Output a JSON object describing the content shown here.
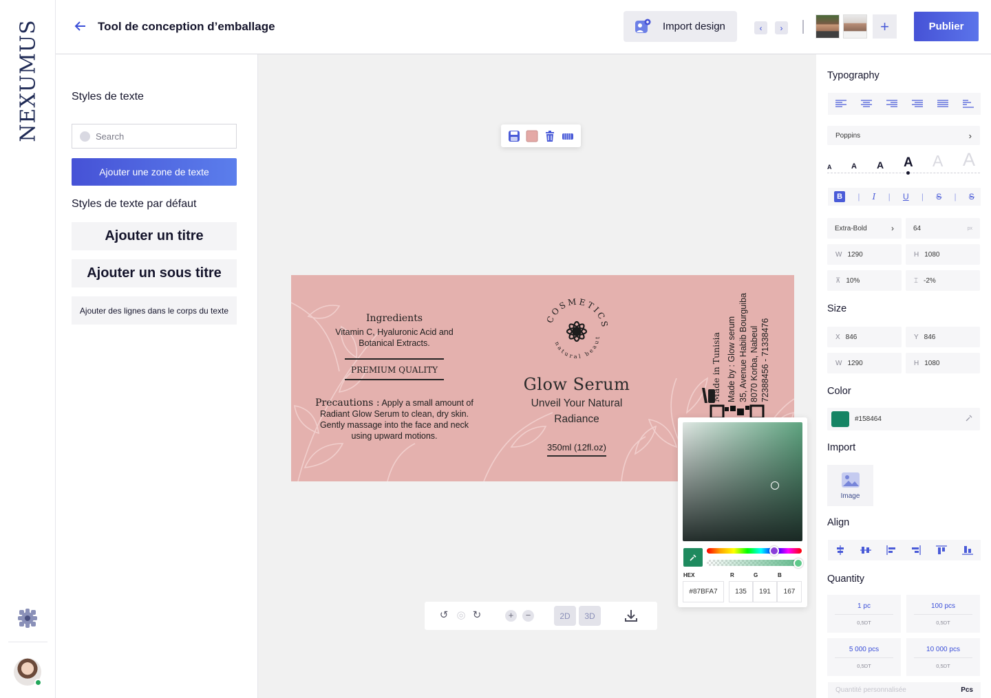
{
  "brand": {
    "logo_text": "NEXUMUS"
  },
  "header": {
    "title": "Tool de conception d’emballage",
    "import_label": "Import design",
    "publish_label": "Publier"
  },
  "left_panel": {
    "heading": "Styles de texte",
    "search_placeholder": "Search",
    "add_text_label": "Ajouter une zone de texte",
    "defaults_heading": "Styles de texte par défaut",
    "title_style": "Ajouter un titre",
    "subtitle_style": "Ajouter un sous titre",
    "body_style": "Ajouter des lignes dans le corps du texte"
  },
  "label": {
    "ingredients_title": "Ingredients",
    "ingredients_text": "Vitamin C, Hyaluronic Acid and Botanical Extracts.",
    "premium": "PREMIUM QUALITY",
    "precautions_title": "Precautions :",
    "precautions_text": "Apply a small amount of Radiant Glow Serum to clean, dry skin. Gently massage into the face and neck using upward motions.",
    "logo_top": "COSMETICS",
    "logo_bottom": "natural beauty",
    "product_name": "Glow Serum",
    "tagline": "Unveil Your Natural Radiance",
    "volume": "350ml (12fl.oz)",
    "made_in": "Made in Tunisia",
    "made_by": "Made by : Glow serum",
    "address": "35, Avenue Habib Bourguiba",
    "city": "8070 Korba, Nabeul",
    "phone": "72388456 - 71338476",
    "badge": "3M"
  },
  "canvas_toolbar": {
    "mode_2d": "2D",
    "mode_3d": "3D"
  },
  "color_picker": {
    "hex_label": "HEX",
    "hex_value": "#87BFA7",
    "r_label": "R",
    "g_label": "G",
    "b_label": "B",
    "r": "135",
    "g": "191",
    "b": "167",
    "swatch_color": "#1e8a5e"
  },
  "right_panel": {
    "typography_heading": "Typography",
    "font_family": "Poppins",
    "font_sizes": [
      "A",
      "A",
      "A",
      "A",
      "A",
      "A"
    ],
    "font_weight": "Extra-Bold",
    "font_size": "64",
    "font_size_unit": "px",
    "w_key": "W",
    "h_key": "H",
    "x_key": "X",
    "y_key": "Y",
    "typo_w": "1290",
    "typo_h": "1080",
    "line_height": "10%",
    "letter_spacing": "-2%",
    "size_heading": "Size",
    "x": "846",
    "y": "846",
    "w": "1290",
    "h": "1080",
    "color_heading": "Color",
    "color_hex": "#158464",
    "import_heading": "Import",
    "image_label": "Image",
    "align_heading": "Align",
    "quantity_heading": "Quantity",
    "quantities": [
      {
        "amount": "1 pc",
        "price": "0,5DT"
      },
      {
        "amount": "100 pcs",
        "price": "0,5DT"
      },
      {
        "amount": "5 000 pcs",
        "price": "0,5DT"
      },
      {
        "amount": "10 000 pcs",
        "price": "0,5DT"
      }
    ],
    "custom_qty_placeholder": "Quantité personnalisée",
    "custom_qty_unit": "Pcs"
  },
  "colors": {
    "accent": "#4652d6",
    "label_bg": "#e4b1ae",
    "selected_color": "#158464"
  }
}
